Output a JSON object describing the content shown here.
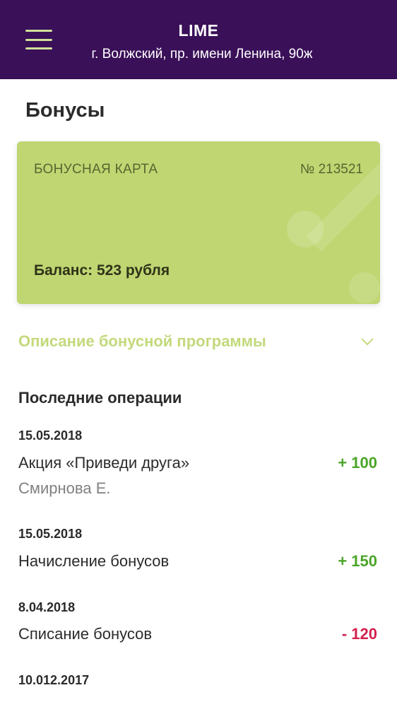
{
  "header": {
    "title": "LIME",
    "address": "г. Волжский, пр. имени Ленина, 90ж",
    "menu_icon": "hamburger-menu-icon"
  },
  "page": {
    "title": "Бонусы"
  },
  "card": {
    "label": "БОНУСНАЯ КАРТА",
    "number": "№ 213521",
    "balance": "Баланс: 523 рубля",
    "color": "#bfd672"
  },
  "program": {
    "label": "Описание бонусной программы",
    "icon": "chevron-down-icon"
  },
  "operations": {
    "title": "Последние операции",
    "items": [
      {
        "date": "15.05.2018",
        "title": "Акция «Приведи друга»",
        "subtitle": "Смирнова Е.",
        "amount": "+ 100"
      },
      {
        "date": "15.05.2018",
        "title": "Начисление бонусов",
        "amount": "+ 150"
      },
      {
        "date": "8.04.2018",
        "title": "Списание бонусов",
        "amount": "- 120"
      },
      {
        "date": "10.012.2017"
      }
    ]
  },
  "colors": {
    "header_bg": "#3a1058",
    "accent": "#c3d97c",
    "positive": "#4aa528",
    "negative": "#d4204e"
  }
}
